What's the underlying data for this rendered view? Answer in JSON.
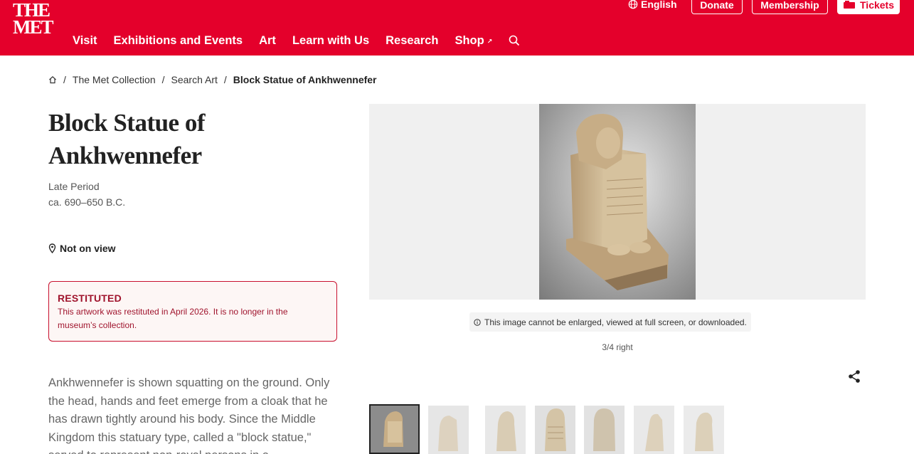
{
  "header": {
    "logo_line1": "THE",
    "logo_line2": "MET",
    "language": "English",
    "donate": "Donate",
    "membership": "Membership",
    "tickets": "Tickets",
    "nav": [
      "Visit",
      "Exhibitions and Events",
      "Art",
      "Learn with Us",
      "Research",
      "Shop"
    ],
    "shop_external_icon": "external-link-icon",
    "brand_color": "#e4002b"
  },
  "breadcrumb": {
    "home_icon": "home-icon",
    "items": [
      "The Met Collection",
      "Search Art"
    ],
    "current": "Block Statue of Ankhwennefer"
  },
  "object": {
    "title": "Block Statue of Ankhwennefer",
    "period": "Late Period",
    "date": "ca. 690–650 B.C.",
    "on_view": "Not on view",
    "restituted_title": "RESTITUTED",
    "restituted_text": "This artwork was restituted in April 2026. It is no longer in the museum’s collection.",
    "description": "Ankhwennefer is shown squatting on the ground. Only the head, hands and feet emerge from a cloak that he has drawn tightly around his body. Since the Middle Kingdom this statuary type, called a \"block statue,\" served to represent non-royal persons in a"
  },
  "image": {
    "notice": "This image cannot be enlarged, viewed at full screen, or downloaded.",
    "caption": "3/4 right",
    "thumbnail_count": 7
  }
}
